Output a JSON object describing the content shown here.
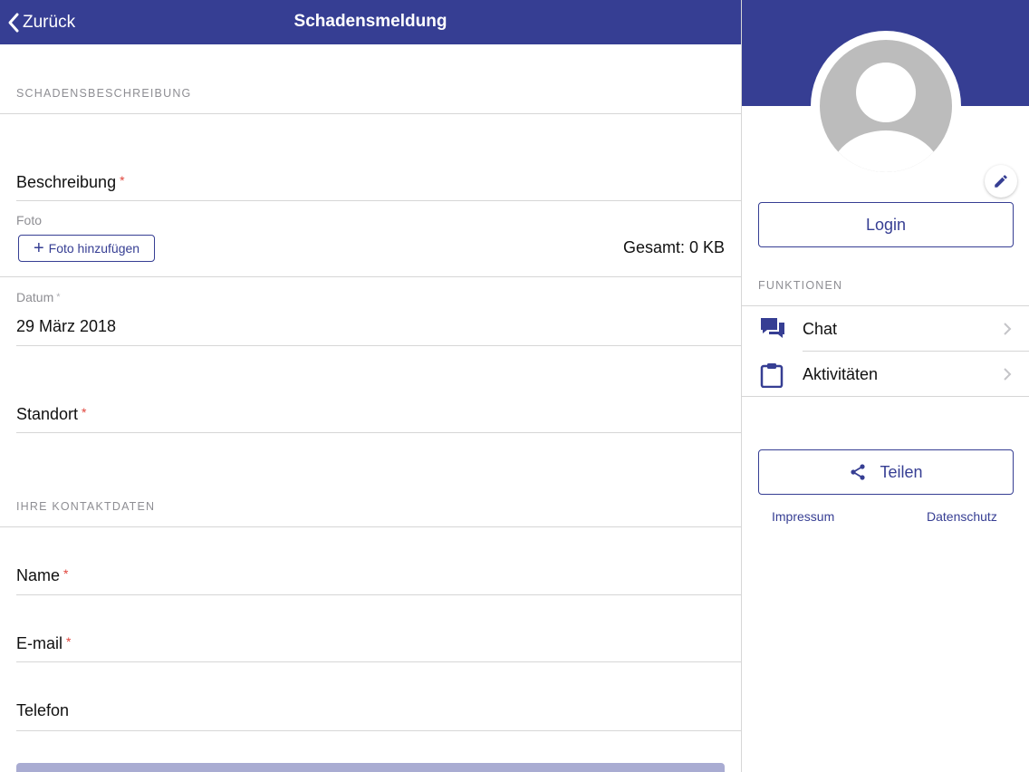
{
  "colors": {
    "accent": "#363e93",
    "required": "#e0443c",
    "disabled_button": "#a9acd2"
  },
  "navbar": {
    "back_label": "Zurück",
    "title": "Schadensmeldung"
  },
  "form": {
    "section_damage": "SCHADENSBESCHREIBUNG",
    "description_label": "Beschreibung",
    "photo_label": "Foto",
    "add_photo_label": "Foto hinzufügen",
    "total_size": "Gesamt: 0 KB",
    "date_label": "Datum",
    "date_value": "29 März 2018",
    "location_label": "Standort",
    "section_contact": "IHRE KONTAKTDATEN",
    "name_label": "Name",
    "email_label": "E-mail",
    "phone_label": "Telefon",
    "required_marker": "*"
  },
  "sidebar": {
    "login_label": "Login",
    "functions_header": "FUNKTIONEN",
    "items": [
      {
        "label": "Chat",
        "icon": "chat-icon"
      },
      {
        "label": "Aktivitäten",
        "icon": "clipboard-icon"
      }
    ],
    "share_label": "Teilen",
    "imprint_label": "Impressum",
    "privacy_label": "Datenschutz"
  }
}
